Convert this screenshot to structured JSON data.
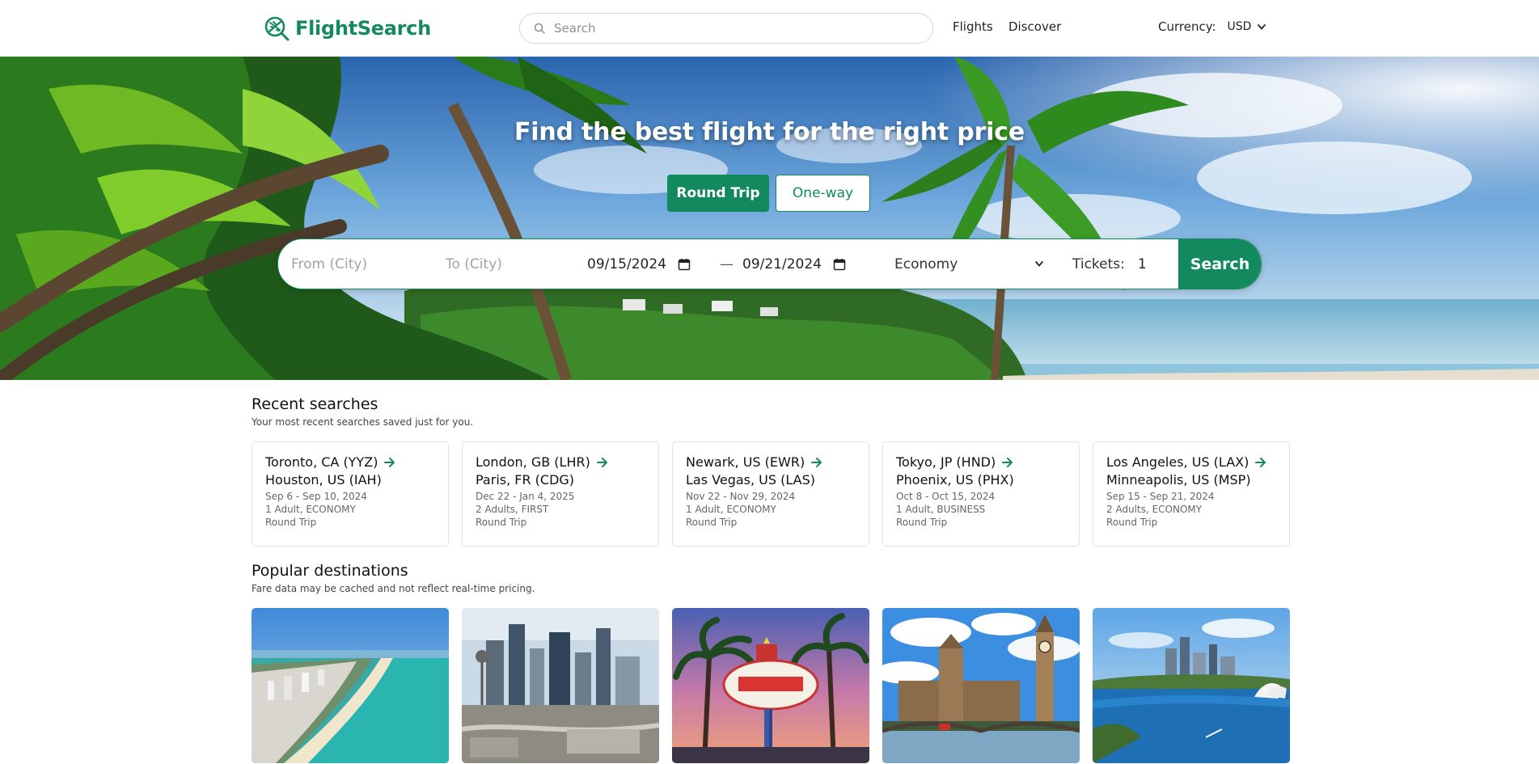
{
  "header": {
    "brand": "FlightSearch",
    "search_placeholder": "Search",
    "nav": {
      "flights": "Flights",
      "discover": "Discover"
    },
    "currency_label": "Currency:",
    "currency_value": "USD"
  },
  "hero": {
    "title": "Find the best flight for the right price",
    "trip_types": {
      "round_trip": "Round Trip",
      "one_way": "One-way"
    },
    "from_placeholder": "From (City)",
    "to_placeholder": "To (City)",
    "depart_date": "09/15/2024",
    "return_date": "09/21/2024",
    "date_separator": "—",
    "cabin": "Economy",
    "tickets_label": "Tickets:",
    "tickets_value": "1",
    "search_button": "Search"
  },
  "recent": {
    "title": "Recent searches",
    "subtitle": "Your most recent searches saved just for you.",
    "items": [
      {
        "from": "Toronto, CA (YYZ)",
        "to": "Houston, US (IAH)",
        "dates": "Sep 6 - Sep 10, 2024",
        "passengers": "1 Adult, ECONOMY",
        "trip": "Round Trip"
      },
      {
        "from": "London, GB (LHR)",
        "to": "Paris, FR (CDG)",
        "dates": "Dec 22 - Jan 4, 2025",
        "passengers": "2 Adults, FIRST",
        "trip": "Round Trip"
      },
      {
        "from": "Newark, US (EWR)",
        "to": "Las Vegas, US (LAS)",
        "dates": "Nov 22 - Nov 29, 2024",
        "passengers": "1 Adult, ECONOMY",
        "trip": "Round Trip"
      },
      {
        "from": "Tokyo, JP (HND)",
        "to": "Phoenix, US (PHX)",
        "dates": "Oct 8 - Oct 15, 2024",
        "passengers": "1 Adult, BUSINESS",
        "trip": "Round Trip"
      },
      {
        "from": "Los Angeles, US (LAX)",
        "to": "Minneapolis, US (MSP)",
        "dates": "Sep 15 - Sep 21, 2024",
        "passengers": "2 Adults, ECONOMY",
        "trip": "Round Trip"
      }
    ]
  },
  "popular": {
    "title": "Popular destinations",
    "subtitle": "Fare data may be cached and not reflect real-time pricing."
  },
  "colors": {
    "brand": "#148a5e",
    "accent": "#138a5e",
    "text": "#1f2328",
    "muted": "#666666"
  }
}
